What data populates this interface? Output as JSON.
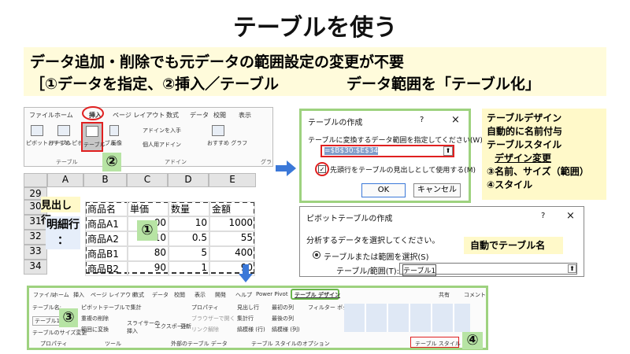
{
  "title": "テーブルを使う",
  "sub1": "データ追加・削除でも元データの範囲設定の変更が不要",
  "sub2a": "［①データを指定、②挿入／テーブル",
  "sub2b": "データ範囲を「テーブル化」",
  "ribbon": {
    "tabs": [
      "ファイル",
      "ホーム",
      "挿入",
      "ページ レイアウト",
      "数式",
      "データ",
      "校閲",
      "表示"
    ],
    "pivot": "ピボット\nテーブル",
    "recpivot": "おすすめ\nピボットテーブル",
    "table": "テーブル",
    "image": "画像",
    "addin": "アドインを入手",
    "personal": "個人用アドイン",
    "recchart": "おすすめ\nグラフ",
    "grp_table": "テーブル",
    "grp_addin": "アドイン",
    "grp_chart": "グラ"
  },
  "badges": {
    "b1": "①",
    "b2": "②",
    "b3": "③",
    "b4": "④"
  },
  "sheet": {
    "cols": [
      "A",
      "B",
      "C",
      "D",
      "E"
    ],
    "rows": [
      "29",
      "30",
      "31",
      "32",
      "33",
      "34"
    ],
    "header_label": "見出し行",
    "detail_label": "明細行\n：",
    "headers": [
      "商品名",
      "単価",
      "数量",
      "金額"
    ],
    "data": [
      [
        "商品A1",
        "00",
        "10",
        "1000"
      ],
      [
        "商品A2",
        "10",
        "0.5",
        "55"
      ],
      [
        "商品B1",
        "80",
        "5",
        "400"
      ],
      [
        "商品B2",
        "90",
        "1",
        "90"
      ]
    ]
  },
  "create_dialog": {
    "title": "テーブルの作成",
    "q": "?",
    "close": "×",
    "prompt": "テーブルに変換するデータ範囲を指定してください(W)",
    "range": "=$B$30:$E$34",
    "checkbox": "先頭行をテーブルの見出しとして使用する(M)",
    "ok": "OK",
    "cancel": "キャンセル"
  },
  "note": {
    "l1": "テーブルデザイン",
    "l2": "自動的に名前付与",
    "l3": "テーブルスタイル",
    "l4": "デザイン変更",
    "l5": "③名前、サイズ（範囲）",
    "l6": "④スタイル"
  },
  "pivot_dialog": {
    "title": "ピボットテーブルの作成",
    "q": "?",
    "close": "×",
    "prompt": "分析するデータを選択してください。",
    "radio": "テーブルまたは範囲を選択(S)",
    "label": "テーブル/範囲(T):",
    "value": "テーブル1",
    "auto": "自動でテーブル名"
  },
  "design": {
    "tabs": [
      "ファイル",
      "ホーム",
      "挿入",
      "ページ レイアウト",
      "数式",
      "データ",
      "校閲",
      "表示",
      "開発",
      "ヘルプ",
      "Power Pivot",
      "テーブル デザイン"
    ],
    "share": "共有",
    "comment": "コメント",
    "tname_label": "テーブル名:",
    "tname": "テーブル1",
    "resize": "テーブルのサイズ変更",
    "pivot": "ピボットテーブルで集計",
    "dup": "重複の削除",
    "range": "範囲に変換",
    "slicer": "スライサーの\n挿入",
    "export": "エクスポート",
    "refresh": "更新",
    "prop": "プロパティ",
    "browser": "ブラウザーで開く",
    "unlink": "リンク解除",
    "chk1": "見出し行",
    "chk2": "集計行",
    "chk3": "縞模様 (行)",
    "chk4": "最初の列",
    "chk5": "最後の列",
    "chk6": "縞模様 (列)",
    "chk7": "フィルター ボタン",
    "g1": "プロパティ",
    "g2": "ツール",
    "g3": "外部のテーブル データ",
    "g4": "テーブル スタイルのオプション",
    "g5": "テーブル スタイル"
  },
  "colors": {
    "green": "#9ed27f",
    "red": "#e02020",
    "blue": "#3b78d8",
    "yellow": "#fff9c9"
  }
}
